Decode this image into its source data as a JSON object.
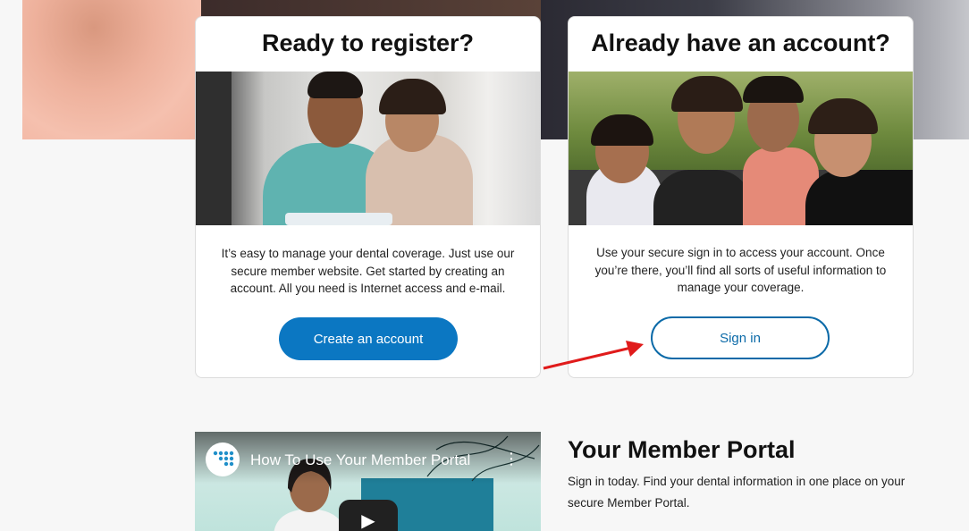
{
  "register_card": {
    "title": "Ready to register?",
    "description": "It’s easy to manage your dental coverage. Just use our secure member website. Get started by creating an account. All you need is Internet access and e-mail.",
    "button_label": "Create an account"
  },
  "signin_card": {
    "title": "Already have an account?",
    "description": "Use your secure sign in to access your account. Once you’re there, you’ll find all sorts of useful information to manage your coverage.",
    "button_label": "Sign in"
  },
  "video": {
    "title": "How To Use Your Member Portal",
    "logo_icon": "tooth-logo-icon",
    "menu_icon": "kebab-menu-icon",
    "play_icon": "play-icon"
  },
  "portal": {
    "title": "Your Member Portal",
    "text": "Sign in today. Find your dental information in one place on your secure Member Portal."
  },
  "colors": {
    "primary_button": "#0b77c2",
    "outline_button": "#0b6aa8",
    "arrow": "#e01b1b"
  }
}
